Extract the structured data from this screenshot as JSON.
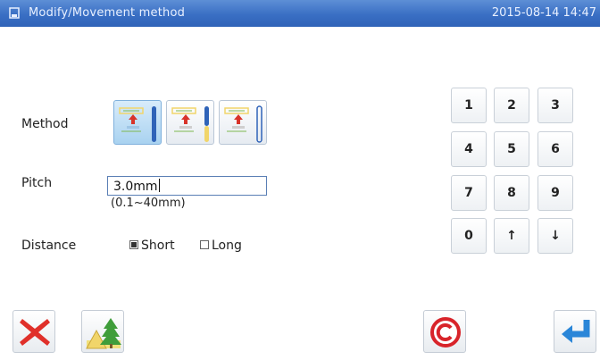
{
  "titlebar": {
    "title": "Modify/Movement method",
    "clock": "2015-08-14 14:47",
    "icon": "pattern-icon"
  },
  "method": {
    "label": "Method",
    "options": [
      "method-1-icon",
      "method-2-icon",
      "method-3-icon"
    ],
    "selected_index": 0
  },
  "pitch": {
    "label": "Pitch",
    "value": "3.0mm",
    "range": "(0.1~40mm)"
  },
  "distance": {
    "label": "Distance",
    "short_label": "Short",
    "long_label": "Long",
    "selected": "Short"
  },
  "keypad": {
    "keys": [
      "1",
      "2",
      "3",
      "4",
      "5",
      "6",
      "7",
      "8",
      "9",
      "0",
      "↑",
      "↓"
    ]
  },
  "bottom": {
    "cancel_icon": "cancel-x-icon",
    "scene_icon": "tree-landscape-icon",
    "clear_icon": "clear-c-icon",
    "enter_icon": "enter-arrow-icon"
  },
  "colors": {
    "titlebar": "#3a6fc4",
    "cancel": "#e0302a",
    "enter": "#2a86d8",
    "clear": "#d8242a"
  }
}
